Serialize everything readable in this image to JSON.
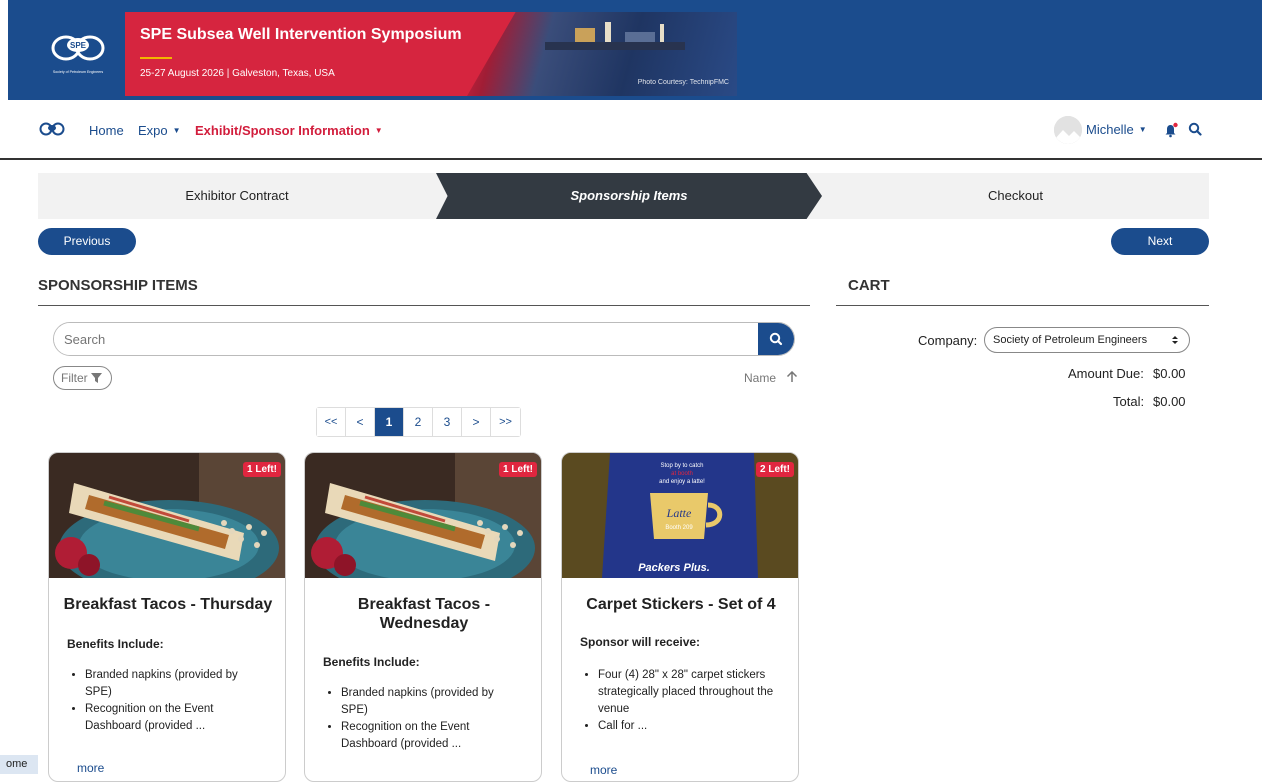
{
  "banner": {
    "title": "SPE Subsea Well Intervention Symposium",
    "subtitle": "25-27 August 2026 | Galveston, Texas, USA",
    "credit": "Photo Courtesy: TechnipFMC",
    "logo_text": "SPE",
    "logo_caption": "Society of Petroleum Engineers"
  },
  "nav": {
    "home": "Home",
    "expo": "Expo",
    "exhibit": "Exhibit/Sponsor Information",
    "user": "Michelle"
  },
  "steps": [
    "Exhibitor Contract",
    "Sponsorship Items",
    "Checkout"
  ],
  "buttons": {
    "previous": "Previous",
    "next": "Next"
  },
  "sponsorship": {
    "title": "SPONSORSHIP ITEMS",
    "search_placeholder": "Search",
    "filter": "Filter",
    "sort": "Name"
  },
  "pager": [
    "<<",
    "<",
    "1",
    "2",
    "3",
    ">",
    ">>"
  ],
  "cards": [
    {
      "badge": "1 Left!",
      "title": "Breakfast Tacos - Thursday",
      "subtitle": "Benefits Include:",
      "items": [
        "Branded napkins (provided by SPE)",
        "Recognition on the Event Dashboard (provided ..."
      ],
      "more": "more"
    },
    {
      "badge": "1 Left!",
      "title": "Breakfast Tacos - Wednesday",
      "subtitle": "Benefits Include:",
      "items": [
        "Branded napkins (provided by SPE)",
        "Recognition on the Event Dashboard (provided ..."
      ],
      "more": "more"
    },
    {
      "badge": "2 Left!",
      "title": "Carpet Stickers - Set of 4",
      "subtitle": "Sponsor will receive:",
      "items": [
        "Four (4) 28\" x 28\" carpet stickers strategically placed throughout the venue",
        "Call for ..."
      ],
      "more": "more",
      "sticker_text": [
        "Stop by to catch",
        "at booth",
        "and enjoy a latte!",
        "Latte",
        "Booth 209",
        "Packers Plus."
      ]
    }
  ],
  "cart": {
    "title": "CART",
    "company_label": "Company:",
    "company_value": "Society of Petroleum Engineers",
    "amount_due_label": "Amount Due:",
    "amount_due": "$0.00",
    "total_label": "Total:",
    "total": "$0.00"
  },
  "home_tab": "ome",
  "colors": {
    "brand_blue": "#1b4c8d",
    "accent_red": "#d21d3c",
    "step_dark": "#333a42"
  }
}
